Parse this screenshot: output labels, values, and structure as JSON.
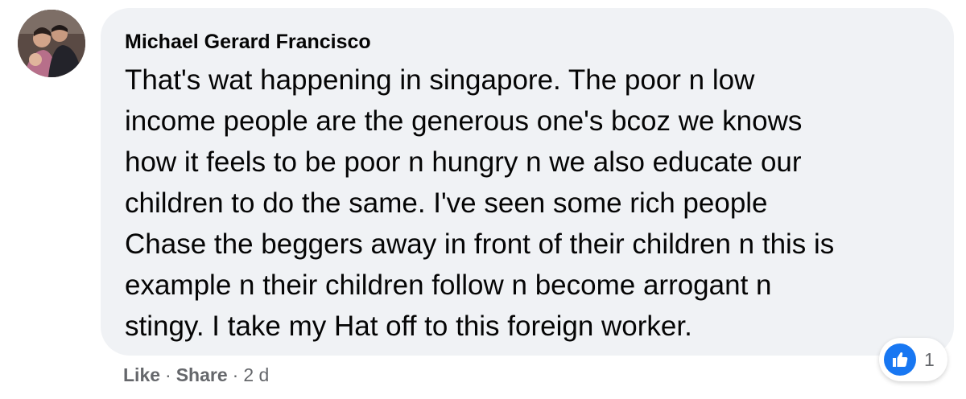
{
  "comment": {
    "author": "Michael Gerard Francisco",
    "text": "That's wat happening in singapore. The poor n low\nincome people are the generous one's bcoz we knows\nhow it feels to be poor n hungry n we also educate our\nchildren to do the same. I've seen some rich people\nChase the beggers away in front of their children n this is\nexample n their children follow n become arrogant n\nstingy. I take my Hat off to this foreign worker.",
    "avatar_icon": "profile-photo"
  },
  "actions": {
    "like_label": "Like",
    "share_label": "Share",
    "timestamp": "2 d"
  },
  "reactions": {
    "icon": "thumbs-up-icon",
    "count": "1",
    "color": "#1877f2"
  },
  "colors": {
    "bubble_bg": "#f0f2f5",
    "text": "#050505",
    "secondary_text": "#65676b"
  }
}
